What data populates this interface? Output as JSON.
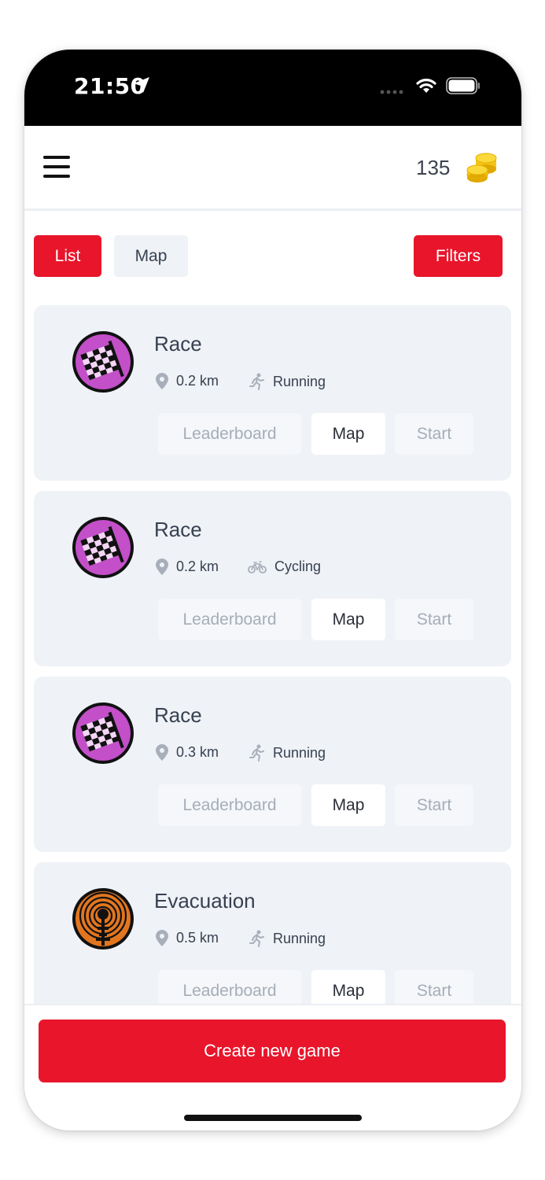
{
  "status": {
    "time": "21:50"
  },
  "header": {
    "coins": "135"
  },
  "tabs": {
    "list_label": "List",
    "map_label": "Map",
    "filters_label": "Filters"
  },
  "games": [
    {
      "title": "Race",
      "distance": "0.2 km",
      "activity": "Running",
      "icon": "race-flag-icon",
      "activity_icon": "running-icon"
    },
    {
      "title": "Race",
      "distance": "0.2 km",
      "activity": "Cycling",
      "icon": "race-flag-icon",
      "activity_icon": "bicycle-icon"
    },
    {
      "title": "Race",
      "distance": "0.3 km",
      "activity": "Running",
      "icon": "race-flag-icon",
      "activity_icon": "running-icon"
    },
    {
      "title": "Evacuation",
      "distance": "0.5 km",
      "activity": "Running",
      "icon": "evacuation-icon",
      "activity_icon": "running-icon"
    }
  ],
  "card_buttons": {
    "leaderboard": "Leaderboard",
    "map": "Map",
    "start": "Start"
  },
  "footer": {
    "create_label": "Create new game"
  },
  "colors": {
    "accent": "#e8152b",
    "race_icon": "#c34fc9",
    "evacuation_icon": "#e2761f",
    "card_bg": "#eff2f6"
  }
}
